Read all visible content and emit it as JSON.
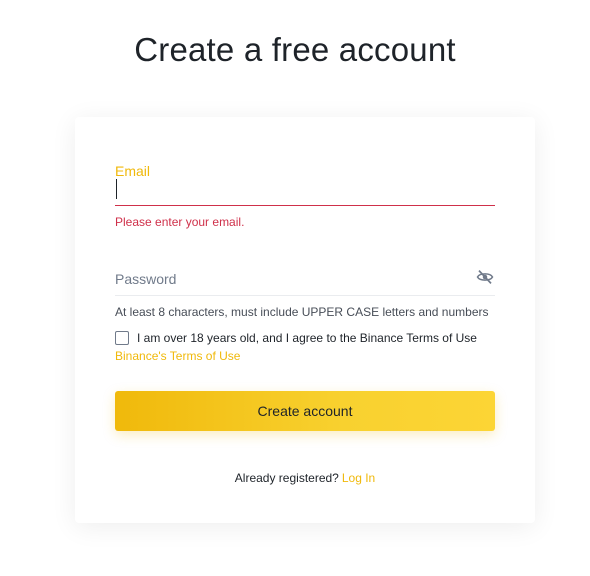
{
  "page": {
    "title": "Create a free account"
  },
  "email": {
    "label": "Email",
    "value": "",
    "error": "Please enter your email."
  },
  "password": {
    "label": "Password",
    "visibility_icon": "eye-off-icon",
    "hint": "At least 8 characters, must include UPPER CASE letters and numbers"
  },
  "terms": {
    "checked": false,
    "text": "I am over 18 years old, and I agree to the Binance Terms of Use",
    "link_label": "Binance's Terms of Use"
  },
  "submit": {
    "label": "Create account"
  },
  "login": {
    "prompt": "Already registered?",
    "link_label": "Log In"
  },
  "colors": {
    "accent": "#f0b90b",
    "error": "#cf304a",
    "text": "#1e2329",
    "muted": "#707a8a"
  }
}
